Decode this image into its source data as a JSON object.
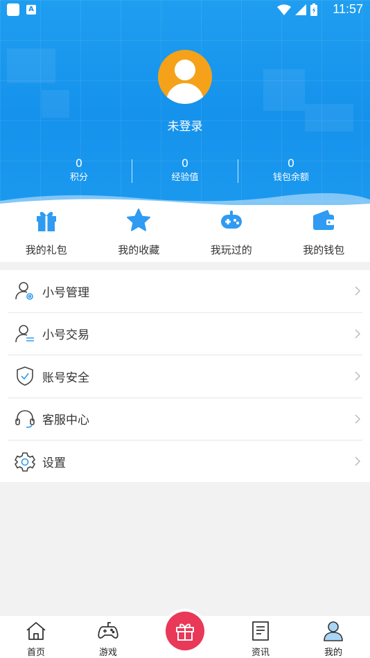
{
  "status_bar": {
    "time": "11:57",
    "notification_badge": "A"
  },
  "profile": {
    "login_status": "未登录"
  },
  "stats": [
    {
      "value": "0",
      "label": "积分"
    },
    {
      "value": "0",
      "label": "经验值"
    },
    {
      "value": "0",
      "label": "钱包余额"
    }
  ],
  "quick_actions": [
    {
      "label": "我的礼包",
      "icon": "gift-icon"
    },
    {
      "label": "我的收藏",
      "icon": "star-icon"
    },
    {
      "label": "我玩过的",
      "icon": "gamepad-icon"
    },
    {
      "label": "我的钱包",
      "icon": "wallet-icon"
    }
  ],
  "menu": [
    {
      "label": "小号管理",
      "icon": "user-settings-icon"
    },
    {
      "label": "小号交易",
      "icon": "user-transfer-icon"
    },
    {
      "label": "账号安全",
      "icon": "shield-check-icon"
    },
    {
      "label": "客服中心",
      "icon": "headset-icon"
    },
    {
      "label": "设置",
      "icon": "gear-icon"
    }
  ],
  "bottom_nav": [
    {
      "label": "首页",
      "icon": "home-icon"
    },
    {
      "label": "游戏",
      "icon": "gamepad-icon"
    },
    {
      "label": "",
      "icon": "gift-icon"
    },
    {
      "label": "资讯",
      "icon": "news-icon"
    },
    {
      "label": "我的",
      "icon": "user-icon",
      "active": true
    }
  ],
  "colors": {
    "primary": "#1592ec",
    "avatar": "#f5a21a",
    "gift_button": "#e93858",
    "icon_blue": "#2f9bf2"
  }
}
